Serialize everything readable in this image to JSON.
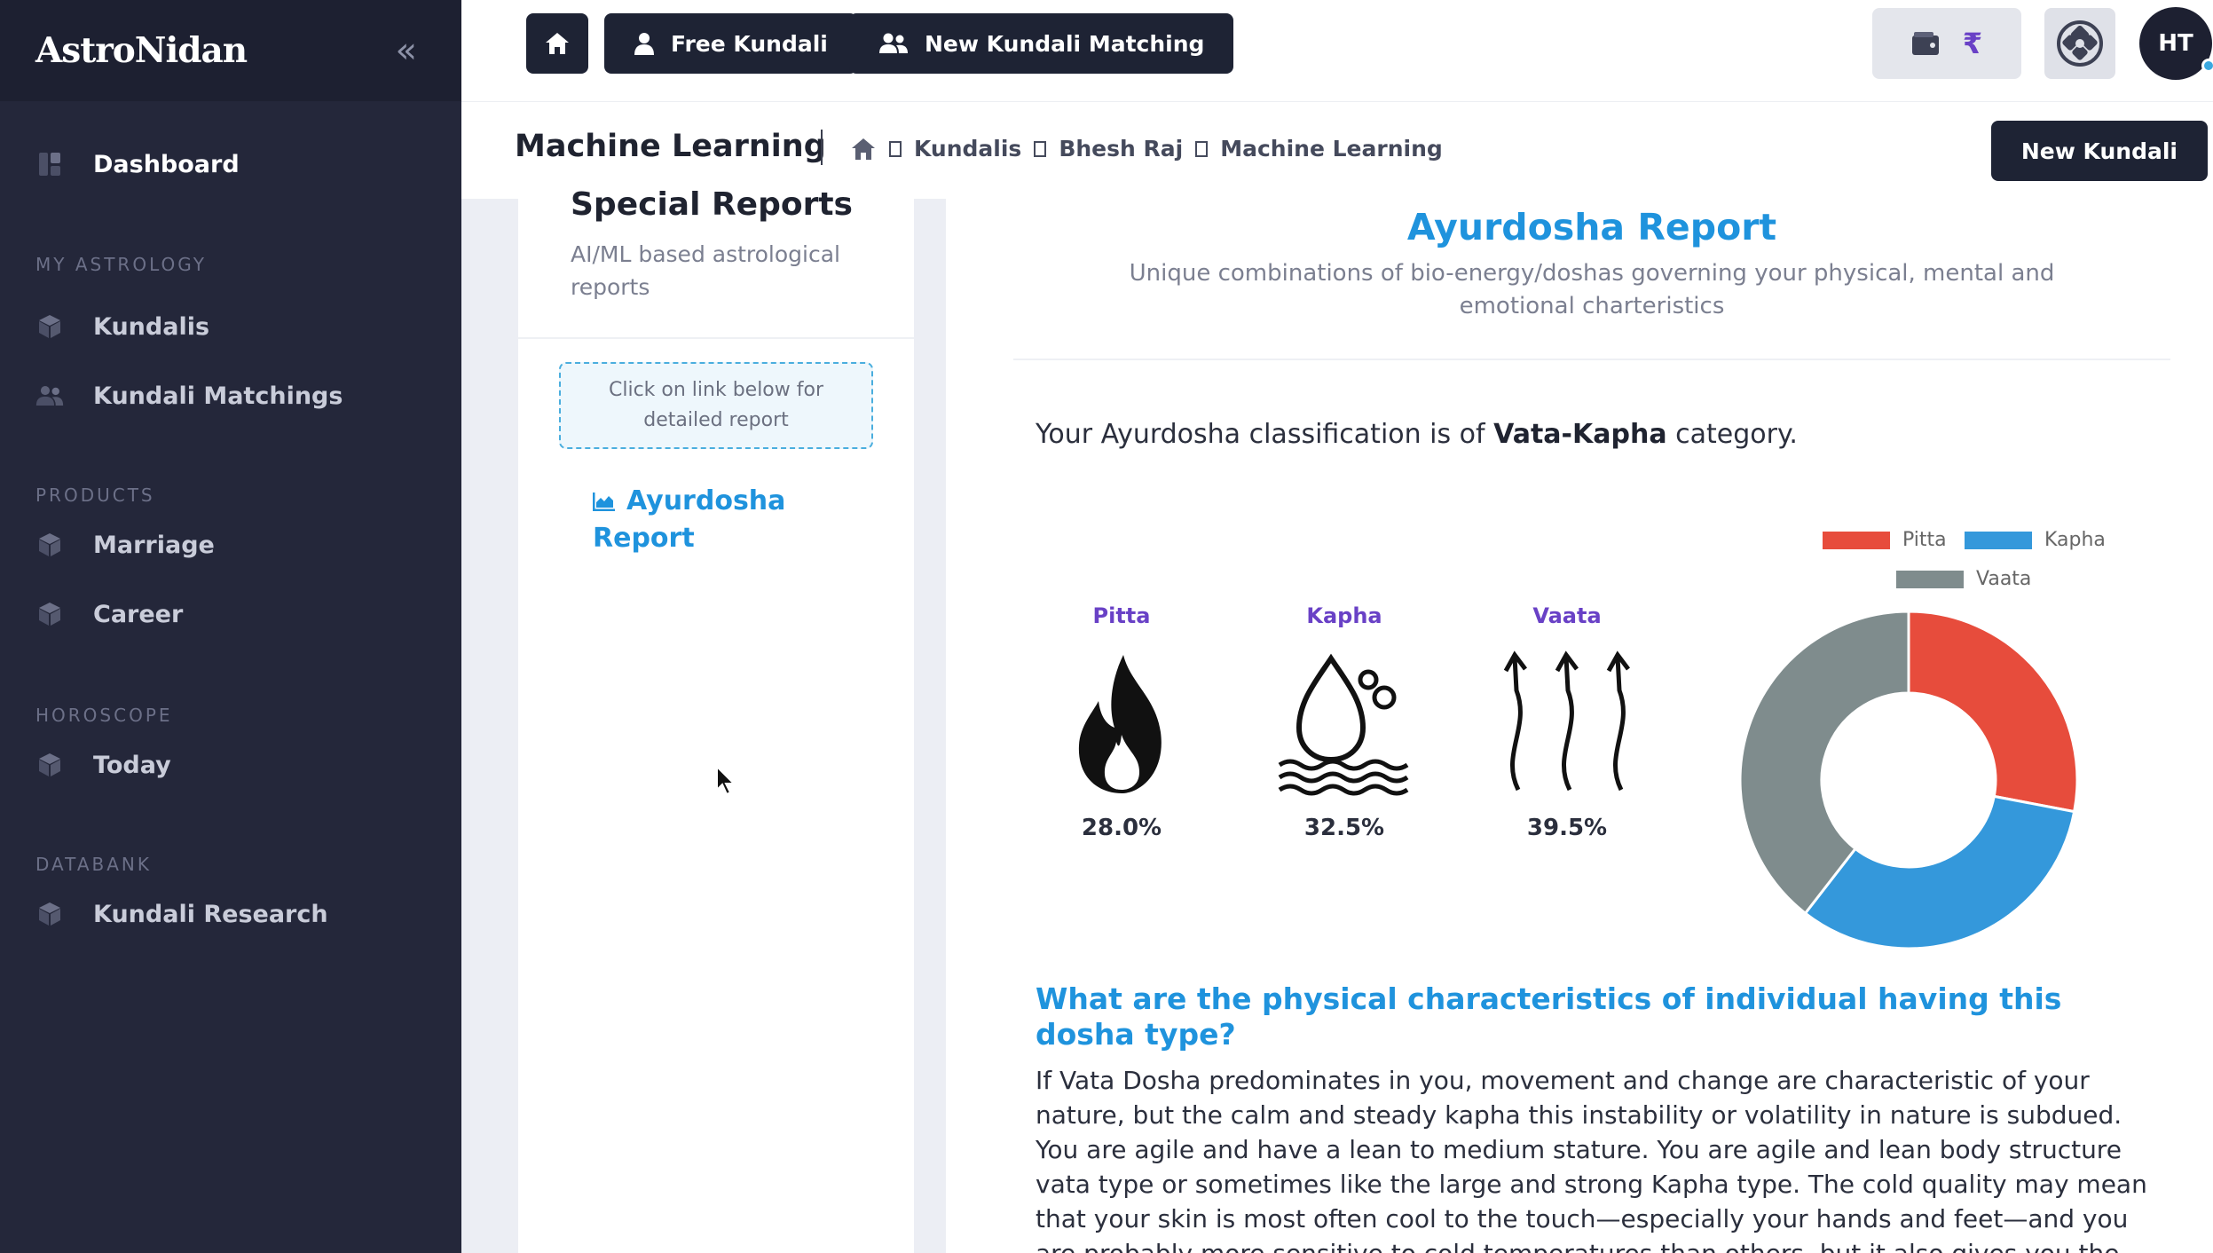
{
  "sidebar": {
    "logo": "AstroNidan",
    "dashboard": "Dashboard",
    "sections": {
      "my_astrology": "MY ASTROLOGY",
      "products": "PRODUCTS",
      "horoscope": "HOROSCOPE",
      "databank": "DATABANK"
    },
    "items": {
      "kundalis": "Kundalis",
      "kundali_matchings": "Kundali Matchings",
      "marriage": "Marriage",
      "career": "Career",
      "today": "Today",
      "kundali_research": "Kundali Research"
    }
  },
  "topbar": {
    "free_kundali": "Free Kundali",
    "new_kundali_matching": "New Kundali Matching",
    "wallet_currency": "₹",
    "avatar_initials": "HT"
  },
  "subheader": {
    "title": "Machine Learning",
    "breadcrumbs": [
      "Kundalis",
      "Bhesh Raj",
      "Machine Learning"
    ],
    "new_kundali": "New Kundali"
  },
  "left_panel": {
    "title": "Special Reports",
    "subtitle": "AI/ML based astrological reports",
    "hint": "Click on link below for detailed report",
    "link": "Ayurdosha Report"
  },
  "report": {
    "title": "Ayurdosha Report",
    "subtitle": "Unique combinations of bio-energy/doshas governing your physical, mental and emotional charteristics",
    "classification_prefix": "Your Ayurdosha classification is of ",
    "classification_value": "Vata-Kapha",
    "classification_suffix": " category.",
    "question": "What are the physical characteristics of individual having this dosha type?",
    "paragraph": "If Vata Dosha predominates in you, movement and change are characteristic of your nature, but the calm and steady kapha this instability or volatility in nature is subdued. You are agile and have a lean to medium stature. You are agile and lean body structure vata type or sometimes like the large and strong Kapha type. The cold quality may mean that your skin is most often cool to the touch—especially your hands and feet—and you are probably more sensitive to cold temperatures than others, but it also gives you the capacity to access a"
  },
  "doshas": [
    {
      "name": "Pitta",
      "value": "28.0%",
      "icon": "fire-icon"
    },
    {
      "name": "Kapha",
      "value": "32.5%",
      "icon": "water-drop-icon"
    },
    {
      "name": "Vaata",
      "value": "39.5%",
      "icon": "air-waves-icon"
    }
  ],
  "colors": {
    "pitta": "#e74c3c",
    "kapha": "#3498db",
    "vaata": "#7f8c8d",
    "accent": "#1f93dd",
    "dosha_label": "#6941c6"
  },
  "chart_data": {
    "type": "pie",
    "variant": "doughnut",
    "categories": [
      "Pitta",
      "Kapha",
      "Vaata"
    ],
    "values": [
      28.0,
      32.5,
      39.5
    ],
    "legend_position": "top"
  }
}
